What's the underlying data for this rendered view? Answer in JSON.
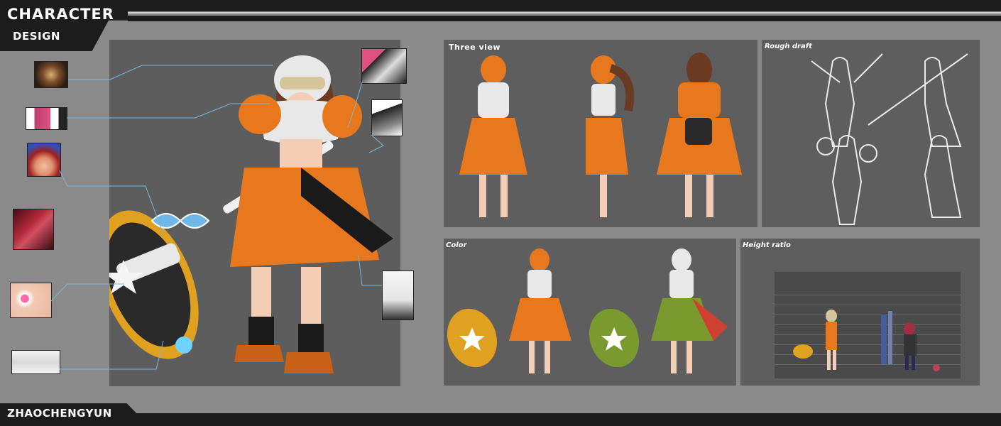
{
  "header": {
    "title_line1": "CHARACTER",
    "title_line2": "DESIGN"
  },
  "footer": {
    "author": "ZHAOCHENGYUN"
  },
  "colors": {
    "bar": "#1c1c1c",
    "background": "#8a8a8a",
    "panel": "#5e5e5e",
    "accent_orange": "#e8781e",
    "leader_blue": "#7bb6d6"
  },
  "panels": {
    "three_view": {
      "title": "Three view"
    },
    "rough_draft": {
      "title": "Rough draft"
    },
    "color": {
      "title": "Color"
    },
    "height_ratio": {
      "title": "Height ratio"
    }
  },
  "icons": {
    "main_figure": "character-illustration",
    "hammer": "hammer-weapon",
    "thumbnails": [
      "hammer-core-detail",
      "belt-detail",
      "hair-bow-detail",
      "armor-detail",
      "goggles-face-detail",
      "weapon-sketch-detail",
      "shoulder-pad-detail",
      "glove-detail",
      "cape-fabric-detail"
    ]
  }
}
